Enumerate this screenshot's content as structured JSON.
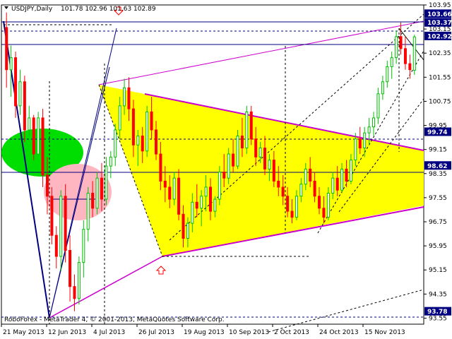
{
  "header": {
    "symbol": "USDJPY,Daily",
    "ohlc": "101.78 102.96 101.63 102.89"
  },
  "copyright": "RoboForex - MetaTrader 4, © 2001-2013, MetaQuotes Software Corp.",
  "colors": {
    "bull": "#00c000",
    "bear": "#ff0000",
    "triangle_fill": "#ffff00",
    "trendline": "#cc00cc",
    "green_zone": "#00dd00",
    "pink_zone": "#ffb6c1",
    "level_line": "#000080",
    "axis_tag_bg": "#000080",
    "arrow": "#ff0000"
  },
  "chart_data": {
    "type": "candlestick",
    "title": "USDJPY,Daily",
    "y_range": [
      93.35,
      103.95
    ],
    "y_ticks": [
      "103.95",
      "103.15",
      "102.35",
      "101.55",
      "100.75",
      "99.95",
      "99.15",
      "98.35",
      "97.55",
      "96.75",
      "95.95",
      "95.15",
      "94.35",
      "93.55"
    ],
    "price_tags": [
      "103.66",
      "103.37",
      "102.92",
      "99.74",
      "98.62",
      "93.78"
    ],
    "x_labels": [
      "21 May 2013",
      "12 Jun 2013",
      "4 Jul 2013",
      "26 Jul 2013",
      "19 Aug 2013",
      "10 Sep 2013",
      "2 Oct 2013",
      "24 Oct 2013",
      "15 Nov 2013"
    ],
    "series": [
      {
        "candles": [
          [
            103.2,
            103.7,
            101.2,
            101.8
          ],
          [
            101.8,
            102.6,
            100.9,
            102.2
          ],
          [
            102.2,
            102.4,
            100.2,
            100.6
          ],
          [
            100.6,
            101.8,
            100.3,
            101.4
          ],
          [
            101.4,
            101.6,
            99.4,
            99.8
          ],
          [
            99.8,
            100.6,
            99.6,
            100.2
          ],
          [
            100.2,
            100.3,
            98.8,
            99.0
          ],
          [
            99.0,
            100.4,
            98.9,
            100.2
          ],
          [
            100.2,
            100.5,
            97.9,
            98.3
          ],
          [
            98.3,
            98.9,
            97.0,
            97.6
          ],
          [
            97.6,
            97.9,
            96.0,
            96.3
          ],
          [
            96.3,
            96.6,
            95.2,
            95.6
          ],
          [
            95.6,
            97.8,
            95.1,
            97.6
          ],
          [
            97.6,
            98.0,
            95.4,
            95.8
          ],
          [
            95.8,
            96.3,
            94.1,
            94.6
          ],
          [
            94.6,
            95.0,
            93.78,
            94.2
          ],
          [
            94.2,
            95.6,
            94.0,
            95.4
          ],
          [
            95.4,
            96.8,
            94.9,
            96.5
          ],
          [
            96.5,
            97.9,
            96.1,
            97.7
          ],
          [
            97.7,
            98.1,
            96.9,
            97.2
          ],
          [
            97.2,
            98.4,
            97.0,
            98.2
          ],
          [
            98.2,
            98.7,
            97.1,
            97.5
          ],
          [
            97.5,
            98.9,
            97.3,
            98.6
          ],
          [
            98.6,
            99.1,
            98.2,
            98.9
          ],
          [
            98.9,
            100.0,
            98.6,
            99.8
          ],
          [
            99.8,
            100.9,
            99.5,
            100.6
          ],
          [
            100.6,
            101.5,
            100.3,
            101.2
          ],
          [
            101.2,
            101.55,
            100.1,
            100.5
          ],
          [
            100.5,
            100.8,
            98.9,
            99.3
          ],
          [
            99.3,
            99.8,
            98.6,
            99.6
          ],
          [
            99.6,
            99.9,
            98.7,
            99.1
          ],
          [
            99.1,
            100.6,
            98.9,
            100.4
          ],
          [
            100.4,
            100.9,
            99.5,
            99.8
          ],
          [
            99.8,
            100.1,
            98.8,
            99.0
          ],
          [
            99.0,
            99.4,
            97.8,
            98.1
          ],
          [
            98.1,
            98.6,
            97.4,
            97.9
          ],
          [
            97.9,
            98.3,
            97.2,
            97.5
          ],
          [
            97.5,
            98.4,
            97.3,
            98.2
          ],
          [
            98.2,
            98.5,
            96.8,
            97.0
          ],
          [
            97.0,
            97.3,
            95.9,
            96.2
          ],
          [
            96.2,
            96.9,
            95.9,
            96.7
          ],
          [
            96.7,
            97.7,
            96.4,
            97.4
          ],
          [
            97.4,
            98.0,
            96.9,
            97.2
          ],
          [
            97.2,
            97.8,
            96.6,
            97.6
          ],
          [
            97.6,
            98.3,
            97.1,
            97.9
          ],
          [
            97.9,
            98.2,
            96.8,
            97.1
          ],
          [
            97.1,
            97.6,
            96.9,
            97.5
          ],
          [
            97.5,
            98.6,
            97.3,
            98.4
          ],
          [
            98.4,
            99.0,
            97.9,
            98.2
          ],
          [
            98.2,
            99.2,
            98.0,
            99.0
          ],
          [
            99.0,
            99.5,
            98.4,
            98.6
          ],
          [
            98.6,
            99.8,
            98.5,
            99.6
          ],
          [
            99.6,
            100.2,
            98.9,
            99.2
          ],
          [
            99.2,
            100.6,
            99.0,
            100.4
          ],
          [
            100.4,
            100.6,
            99.3,
            99.5
          ],
          [
            99.5,
            99.9,
            98.6,
            98.9
          ],
          [
            98.9,
            99.4,
            98.7,
            99.2
          ],
          [
            99.2,
            99.6,
            98.3,
            98.5
          ],
          [
            98.5,
            99.0,
            98.1,
            98.8
          ],
          [
            98.8,
            99.1,
            97.9,
            98.1
          ],
          [
            98.1,
            98.6,
            97.6,
            97.9
          ],
          [
            97.9,
            98.3,
            97.3,
            97.6
          ],
          [
            97.6,
            97.9,
            96.9,
            97.1
          ],
          [
            97.1,
            97.5,
            96.7,
            96.9
          ],
          [
            96.9,
            97.8,
            96.8,
            97.6
          ],
          [
            97.6,
            98.2,
            97.4,
            98.0
          ],
          [
            98.0,
            98.7,
            97.8,
            98.5
          ],
          [
            98.5,
            98.9,
            97.9,
            98.1
          ],
          [
            98.1,
            98.4,
            97.4,
            97.6
          ],
          [
            97.6,
            97.9,
            97.0,
            97.2
          ],
          [
            97.2,
            97.6,
            96.7,
            96.9
          ],
          [
            96.9,
            97.9,
            96.8,
            97.7
          ],
          [
            97.7,
            98.4,
            97.5,
            98.2
          ],
          [
            98.2,
            98.6,
            97.6,
            97.8
          ],
          [
            97.8,
            98.7,
            97.7,
            98.5
          ],
          [
            98.5,
            98.8,
            97.9,
            98.1
          ],
          [
            98.1,
            99.0,
            98.0,
            98.8
          ],
          [
            98.8,
            99.7,
            98.6,
            99.5
          ],
          [
            99.5,
            99.9,
            99.0,
            99.2
          ],
          [
            99.2,
            99.9,
            98.9,
            99.7
          ],
          [
            99.7,
            100.2,
            99.3,
            99.9
          ],
          [
            99.9,
            100.4,
            99.6,
            100.2
          ],
          [
            100.2,
            101.2,
            100.0,
            101.0
          ],
          [
            101.0,
            101.6,
            100.8,
            101.4
          ],
          [
            101.4,
            102.1,
            101.2,
            101.9
          ],
          [
            101.9,
            102.4,
            101.5,
            102.2
          ],
          [
            102.2,
            103.1,
            102.0,
            102.9
          ],
          [
            102.9,
            103.37,
            102.3,
            102.5
          ],
          [
            102.5,
            102.9,
            101.8,
            102.0
          ],
          [
            102.0,
            102.3,
            101.5,
            101.8
          ],
          [
            101.78,
            102.96,
            101.63,
            102.89
          ]
        ]
      }
    ]
  }
}
